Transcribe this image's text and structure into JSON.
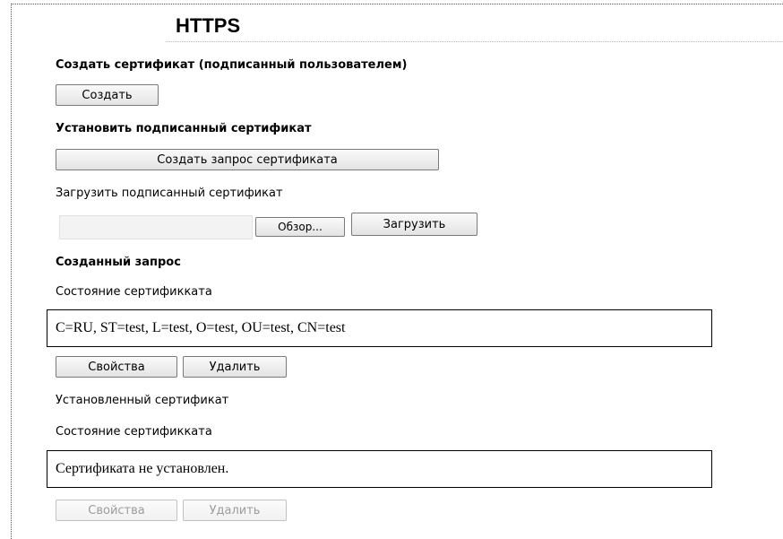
{
  "page": {
    "title": "HTTPS"
  },
  "create_section": {
    "heading": "Создать сертификат (подписанный пользователем)",
    "create_button": "Создать"
  },
  "install_section": {
    "heading": "Установить подписанный сертификат",
    "create_request_button": "Создать запрос сертификата",
    "upload_label": "Загрузить подписанный сертификат",
    "file_input_value": "",
    "browse_button": "Обзор...",
    "upload_button": "Загрузить"
  },
  "request_section": {
    "heading": "Созданный запрос",
    "status_label": "Состояние сертификката",
    "status_value": "C=RU, ST=test, L=test, O=test, OU=test, CN=test",
    "properties_button": "Свойства",
    "delete_button": "Удалить"
  },
  "installed_section": {
    "heading": "Установленный сертификат",
    "status_label": "Состояние сертификката",
    "status_value": "Сертификата не установлен.",
    "properties_button": "Свойства",
    "delete_button": "Удалить",
    "buttons_disabled": true
  }
}
